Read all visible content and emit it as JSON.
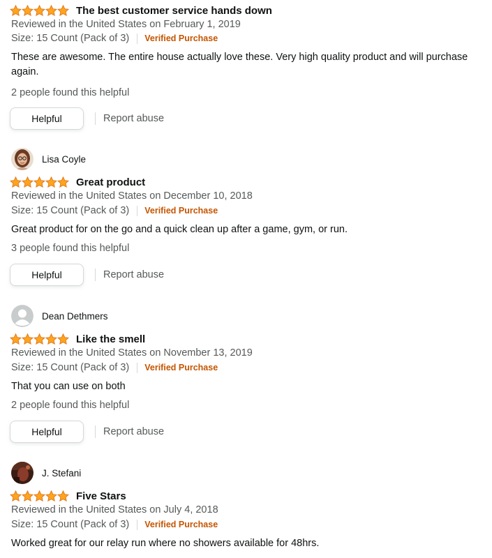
{
  "colors": {
    "star": "#FFA41C",
    "star_outline": "#DE7921",
    "verified": "#C45500",
    "meta_text": "#565959",
    "text": "#0F1111"
  },
  "reviews": [
    {
      "reviewer": "",
      "avatar": "none",
      "rating": 5,
      "title": "The best customer service hands down",
      "date_line": "Reviewed in the United States on February 1, 2019",
      "format": "Size: 15 Count (Pack of 3)",
      "verified": "Verified Purchase",
      "body": "These are awesome. The entire house actually love these. Very high quality product and will purchase again.",
      "helpful_count": "2 people found this helpful",
      "helpful_label": "Helpful",
      "report_label": "Report abuse"
    },
    {
      "reviewer": "Lisa Coyle",
      "avatar": "photo-woman-glasses",
      "rating": 5,
      "title": "Great product",
      "date_line": "Reviewed in the United States on December 10, 2018",
      "format": "Size: 15 Count (Pack of 3)",
      "verified": "Verified Purchase",
      "body": "Great product for on the go and a quick clean up after a game, gym, or run.",
      "helpful_count": "3 people found this helpful",
      "helpful_label": "Helpful",
      "report_label": "Report abuse"
    },
    {
      "reviewer": "Dean Dethmers",
      "avatar": "default-user-icon",
      "rating": 5,
      "title": "Like the smell",
      "date_line": "Reviewed in the United States on November 13, 2019",
      "format": "Size: 15 Count (Pack of 3)",
      "verified": "Verified Purchase",
      "body": "That you can use on both",
      "helpful_count": "2 people found this helpful",
      "helpful_label": "Helpful",
      "report_label": "Report abuse"
    },
    {
      "reviewer": "J. Stefani",
      "avatar": "photo-dark",
      "rating": 5,
      "title": "Five Stars",
      "date_line": "Reviewed in the United States on July 4, 2018",
      "format": "Size: 15 Count (Pack of 3)",
      "verified": "Verified Purchase",
      "body": "Worked great for our relay run where no showers available for 48hrs.",
      "helpful_count": "",
      "helpful_label": "",
      "report_label": ""
    }
  ]
}
